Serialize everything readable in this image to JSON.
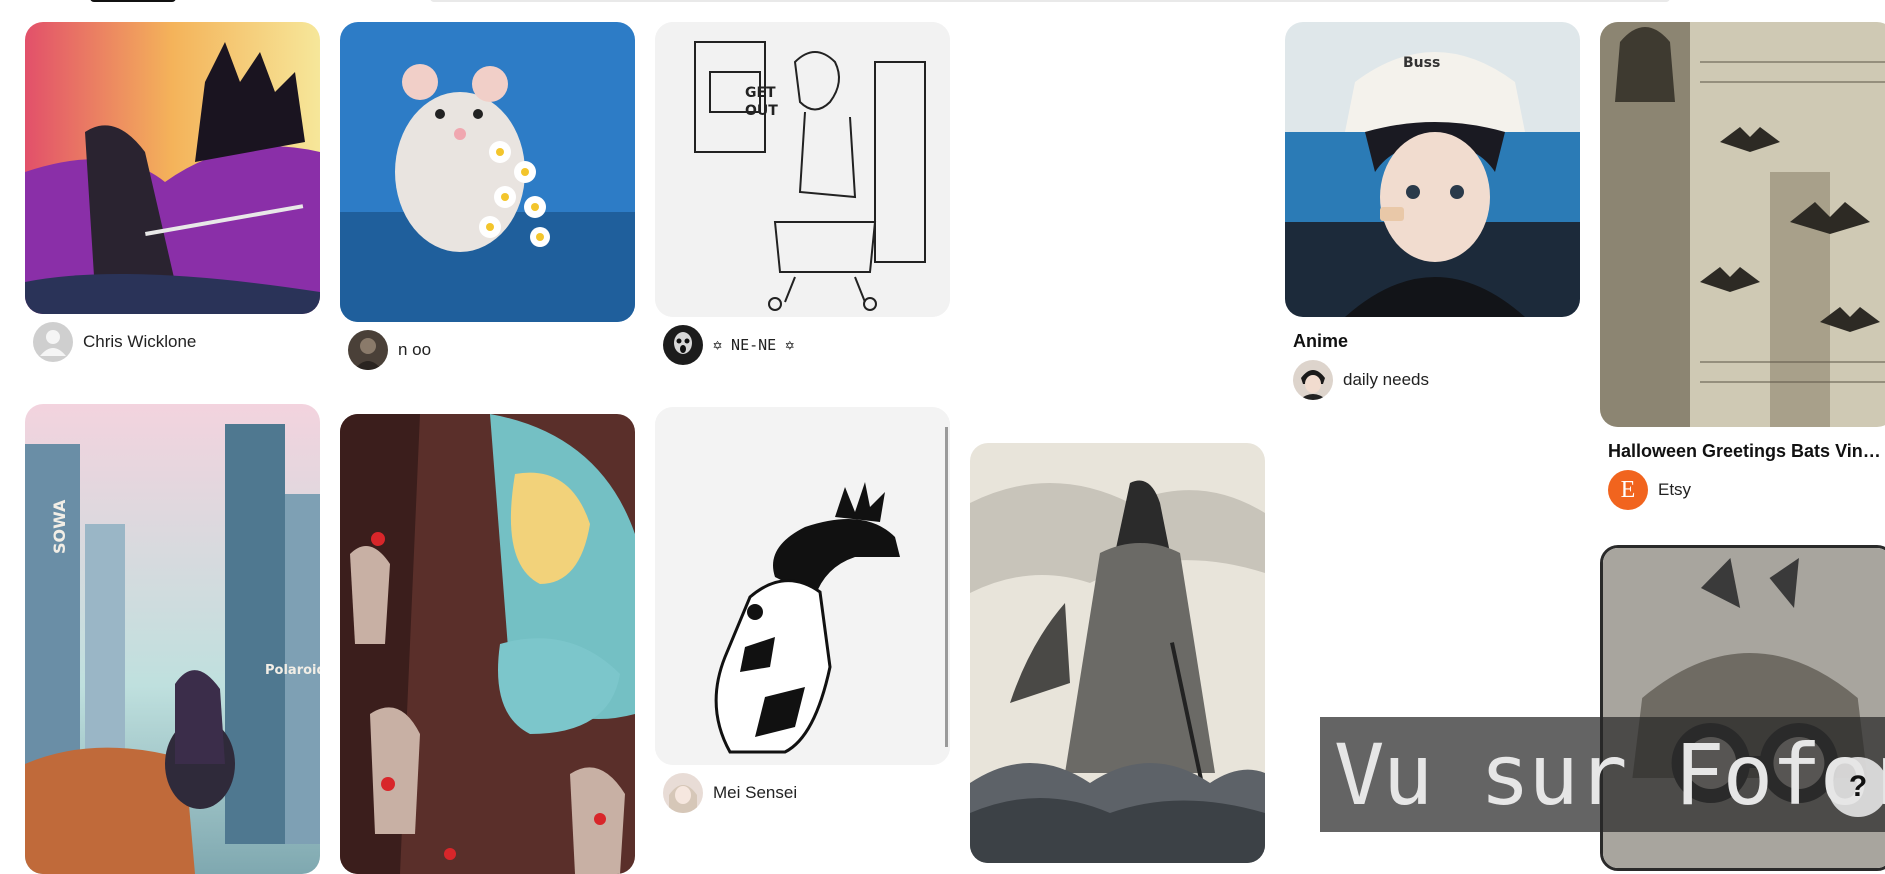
{
  "pins": [
    {
      "id": "knight",
      "author": "Chris Wicklone",
      "avatar_icon": "default-user-icon"
    },
    {
      "id": "mouse",
      "author": "n oo",
      "avatar_icon": "user-photo-icon"
    },
    {
      "id": "get-out",
      "author": "✡ NE-NE ✡",
      "avatar_icon": "user-photo-icon",
      "image_text": [
        "GET",
        "OUT"
      ]
    },
    {
      "id": "anime-boy",
      "title": "Anime",
      "author": "daily needs",
      "avatar_icon": "user-photo-icon",
      "image_text": "Buss"
    },
    {
      "id": "bats",
      "title": "Halloween Greetings Bats Vintag...",
      "author": "Etsy",
      "avatar_letter": "E",
      "avatar_color": "#F1641E"
    },
    {
      "id": "city-girl",
      "image_text": [
        "SOWA",
        "Polaroid"
      ]
    },
    {
      "id": "sorceress"
    },
    {
      "id": "ink-figure",
      "author": "Mei Sensei",
      "avatar_icon": "user-photo-icon"
    },
    {
      "id": "samurai"
    },
    {
      "id": "steampunk-hat"
    }
  ],
  "overlay": {
    "text": "Vu sur Foforum"
  },
  "help": {
    "label": "?"
  }
}
